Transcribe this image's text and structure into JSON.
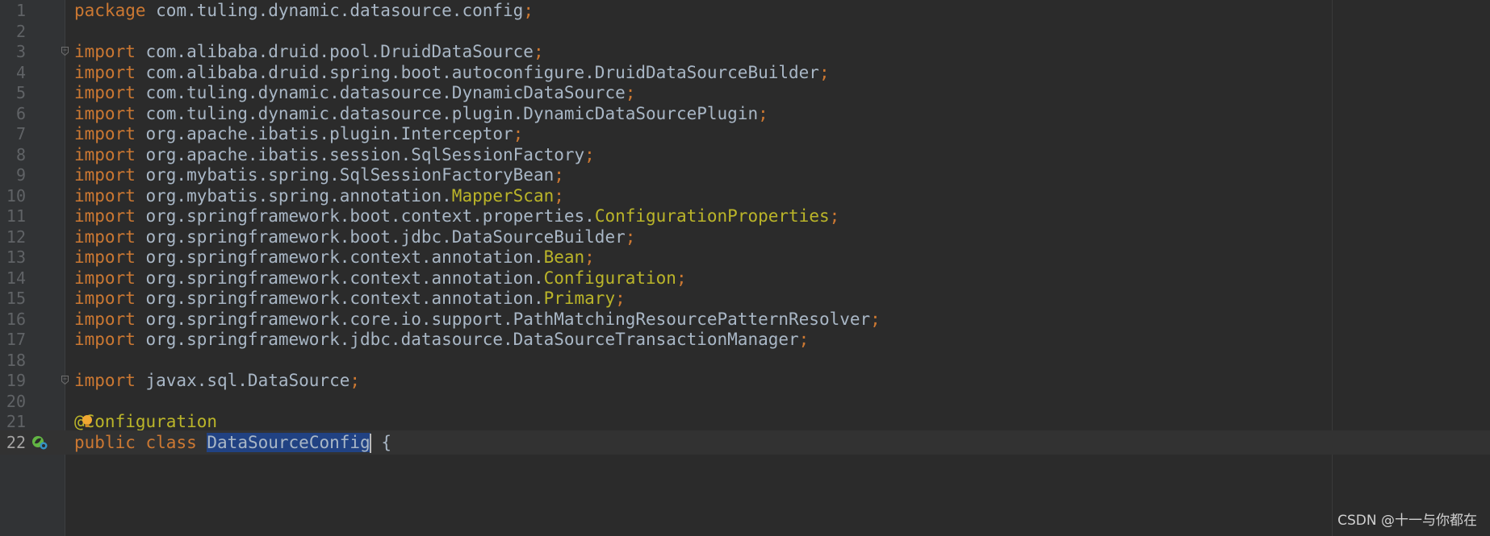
{
  "editor": {
    "lines": [
      {
        "num": "1",
        "parts": [
          {
            "t": "package",
            "c": "kw"
          },
          {
            "t": " com.tuling.dynamic.datasource.config",
            "c": "pkg"
          },
          {
            "t": ";",
            "c": "semi"
          }
        ]
      },
      {
        "num": "2",
        "parts": []
      },
      {
        "num": "3",
        "fold": true,
        "parts": [
          {
            "t": "import",
            "c": "kw"
          },
          {
            "t": " com.alibaba.druid.pool.DruidDataSource",
            "c": "pkg"
          },
          {
            "t": ";",
            "c": "semi"
          }
        ]
      },
      {
        "num": "4",
        "parts": [
          {
            "t": "import",
            "c": "kw"
          },
          {
            "t": " com.alibaba.druid.spring.boot.autoconfigure.DruidDataSourceBuilder",
            "c": "pkg"
          },
          {
            "t": ";",
            "c": "semi"
          }
        ]
      },
      {
        "num": "5",
        "parts": [
          {
            "t": "import",
            "c": "kw"
          },
          {
            "t": " com.tuling.dynamic.datasource.DynamicDataSource",
            "c": "pkg"
          },
          {
            "t": ";",
            "c": "semi"
          }
        ]
      },
      {
        "num": "6",
        "parts": [
          {
            "t": "import",
            "c": "kw"
          },
          {
            "t": " com.tuling.dynamic.datasource.plugin.DynamicDataSourcePlugin",
            "c": "pkg"
          },
          {
            "t": ";",
            "c": "semi"
          }
        ]
      },
      {
        "num": "7",
        "parts": [
          {
            "t": "import",
            "c": "kw"
          },
          {
            "t": " org.apache.ibatis.plugin.Interceptor",
            "c": "pkg"
          },
          {
            "t": ";",
            "c": "semi"
          }
        ]
      },
      {
        "num": "8",
        "parts": [
          {
            "t": "import",
            "c": "kw"
          },
          {
            "t": " org.apache.ibatis.session.SqlSessionFactory",
            "c": "pkg"
          },
          {
            "t": ";",
            "c": "semi"
          }
        ]
      },
      {
        "num": "9",
        "parts": [
          {
            "t": "import",
            "c": "kw"
          },
          {
            "t": " org.mybatis.spring.SqlSessionFactoryBean",
            "c": "pkg"
          },
          {
            "t": ";",
            "c": "semi"
          }
        ]
      },
      {
        "num": "10",
        "parts": [
          {
            "t": "import",
            "c": "kw"
          },
          {
            "t": " org.mybatis.spring.annotation.",
            "c": "pkg"
          },
          {
            "t": "MapperScan",
            "c": "ann"
          },
          {
            "t": ";",
            "c": "semi"
          }
        ]
      },
      {
        "num": "11",
        "parts": [
          {
            "t": "import",
            "c": "kw"
          },
          {
            "t": " org.springframework.boot.context.properties.",
            "c": "pkg"
          },
          {
            "t": "ConfigurationProperties",
            "c": "ann"
          },
          {
            "t": ";",
            "c": "semi"
          }
        ]
      },
      {
        "num": "12",
        "parts": [
          {
            "t": "import",
            "c": "kw"
          },
          {
            "t": " org.springframework.boot.jdbc.DataSourceBuilder",
            "c": "pkg"
          },
          {
            "t": ";",
            "c": "semi"
          }
        ]
      },
      {
        "num": "13",
        "parts": [
          {
            "t": "import",
            "c": "kw"
          },
          {
            "t": " org.springframework.context.annotation.",
            "c": "pkg"
          },
          {
            "t": "Bean",
            "c": "ann"
          },
          {
            "t": ";",
            "c": "semi"
          }
        ]
      },
      {
        "num": "14",
        "parts": [
          {
            "t": "import",
            "c": "kw"
          },
          {
            "t": " org.springframework.context.annotation.",
            "c": "pkg"
          },
          {
            "t": "Configuration",
            "c": "ann"
          },
          {
            "t": ";",
            "c": "semi"
          }
        ]
      },
      {
        "num": "15",
        "parts": [
          {
            "t": "import",
            "c": "kw"
          },
          {
            "t": " org.springframework.context.annotation.",
            "c": "pkg"
          },
          {
            "t": "Primary",
            "c": "ann"
          },
          {
            "t": ";",
            "c": "semi"
          }
        ]
      },
      {
        "num": "16",
        "parts": [
          {
            "t": "import",
            "c": "kw"
          },
          {
            "t": " org.springframework.core.io.support.PathMatchingResourcePatternResolver",
            "c": "pkg"
          },
          {
            "t": ";",
            "c": "semi"
          }
        ]
      },
      {
        "num": "17",
        "parts": [
          {
            "t": "import",
            "c": "kw"
          },
          {
            "t": " org.springframework.jdbc.datasource.DataSourceTransactionManager",
            "c": "pkg"
          },
          {
            "t": ";",
            "c": "semi"
          }
        ]
      },
      {
        "num": "18",
        "parts": []
      },
      {
        "num": "19",
        "fold": true,
        "parts": [
          {
            "t": "import",
            "c": "kw"
          },
          {
            "t": " javax.sql.DataSource",
            "c": "pkg"
          },
          {
            "t": ";",
            "c": "semi"
          }
        ]
      },
      {
        "num": "20",
        "parts": []
      },
      {
        "num": "21",
        "bulb": true,
        "parts": [
          {
            "t": "@Configuration",
            "c": "ann"
          }
        ]
      },
      {
        "num": "22",
        "current": true,
        "gutter_icon": "spring-bean-icon",
        "parts": [
          {
            "t": "public",
            "c": "kw"
          },
          {
            "t": " ",
            "c": "pkg"
          },
          {
            "t": "class",
            "c": "kw"
          },
          {
            "t": " ",
            "c": "pkg"
          },
          {
            "t": "DataSourceConfi",
            "c": "sel"
          },
          {
            "t": "g",
            "c": "sel",
            "caret": true
          },
          {
            "t": " {",
            "c": "pkg"
          }
        ]
      }
    ]
  },
  "colors": {
    "background": "#2b2b2b",
    "keyword": "#cc7832",
    "annotation": "#bbb529",
    "text": "#a9b7c6",
    "selection": "#214283",
    "line_number": "#606366"
  },
  "watermark": "CSDN @十一与你都在"
}
